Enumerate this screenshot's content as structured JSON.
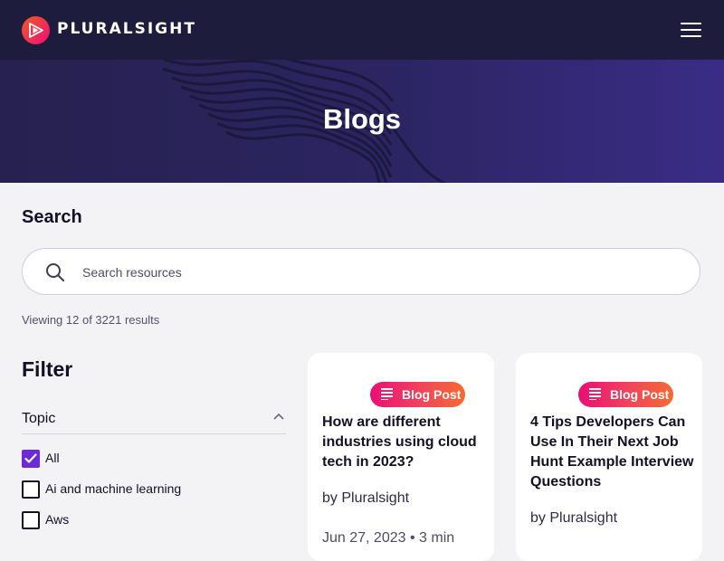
{
  "header": {
    "brand": "PLURALSIGHT",
    "menu_icon": "hamburger-icon",
    "logo_icon": "pluralsight-play-icon"
  },
  "hero": {
    "title": "Blogs"
  },
  "search": {
    "heading": "Search",
    "placeholder": "Search resources",
    "value": "",
    "icon": "search-icon"
  },
  "results": {
    "text": "Viewing 12 of 3221 results"
  },
  "filter": {
    "heading": "Filter",
    "topic": {
      "label": "Topic",
      "expanded": true,
      "options": [
        {
          "label": "All",
          "checked": true
        },
        {
          "label": "Ai and machine learning",
          "checked": false
        },
        {
          "label": "Aws",
          "checked": false
        }
      ]
    }
  },
  "cards": [
    {
      "badge": "Blog Post",
      "title": "How are different industries using cloud tech in 2023?",
      "author": "by Pluralsight",
      "meta": "Jun 27, 2023 • 3 min"
    },
    {
      "badge": "Blog Post",
      "title": "4 Tips Developers Can Use In Their Next Job Hunt Example Interview Questions",
      "author": "by Pluralsight",
      "meta": ""
    }
  ],
  "colors": {
    "header_bg": "#1e1c3d",
    "hero_bg": "#2c2563",
    "accent_purple": "#6d28d9",
    "badge_start": "#ec0e75",
    "badge_end": "#f46b32"
  }
}
